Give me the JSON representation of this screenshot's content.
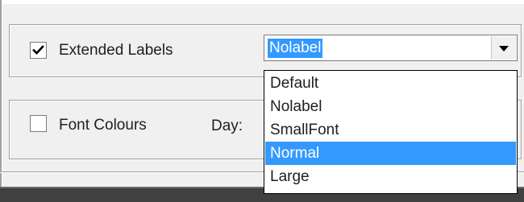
{
  "extended_labels": {
    "label": "Extended Labels",
    "checked": true
  },
  "label_style": {
    "selected": "Nolabel",
    "options": [
      "Default",
      "Nolabel",
      "SmallFont",
      "Normal",
      "Large"
    ],
    "highlighted": "Normal"
  },
  "font_colours": {
    "label": "Font Colours",
    "checked": false
  },
  "day_label": "Day:",
  "colors": {
    "highlight": "#3399ff",
    "bottom_bar": "#404040"
  }
}
